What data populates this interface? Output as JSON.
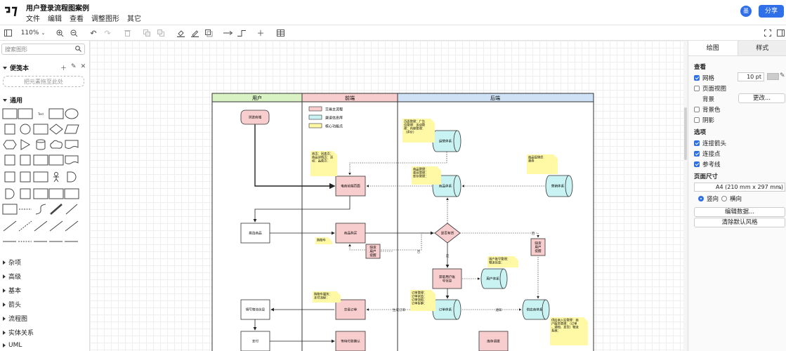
{
  "app": {
    "title": "用户登录流程图案例",
    "avatar_letter": "墨",
    "share_label": "分享"
  },
  "menu": [
    "文件",
    "编辑",
    "查看",
    "调整图形",
    "其它"
  ],
  "toolbar": {
    "zoom": "110%"
  },
  "sidebar": {
    "search_placeholder": "搜索图形",
    "favorites_label": "便笺本",
    "drop_hint": "把元素拖至此处",
    "general_label": "通用",
    "libraries": [
      "杂项",
      "高级",
      "基本",
      "箭头",
      "流程图",
      "实体关系",
      "UML"
    ]
  },
  "panel": {
    "tabs": [
      "绘图",
      "样式"
    ],
    "view_title": "查看",
    "grid_label": "网格",
    "grid_size": "10 pt",
    "page_view_label": "页面视图",
    "background_label": "背景",
    "change_label": "更改...",
    "bg_color_label": "背景色",
    "shadow_label": "阴影",
    "options_title": "选项",
    "connection_arrows_label": "连接箭头",
    "connection_points_label": "连接点",
    "guides_label": "参考线",
    "page_size_title": "页面尺寸",
    "page_size_value": "A4 (210 mm x 297 mm)",
    "portrait_label": "竖向",
    "landscape_label": "横向",
    "edit_data_label": "编辑数据...",
    "clear_style_label": "清除默认风格"
  },
  "diagram": {
    "lanes": [
      "用户",
      "前端",
      "后端"
    ],
    "legend": [
      "交易主流程",
      "渠道信息库",
      "核心功能点"
    ],
    "nodes": {
      "browse": "浏览商城",
      "home": "电商前端页面",
      "select": "挑选商品",
      "buy": "商品购买",
      "fill": "填写物流信息",
      "order": "交易订单",
      "pay": "支付",
      "wait": "等待付款确认",
      "ops": "运营体系",
      "goods": "商品体系",
      "market": "营销体系",
      "exist": "是否有货",
      "getuser": "获取用户账号信息",
      "user": "用户体系",
      "ordersys": "订单体系",
      "supply": "供应商体系",
      "stock": "库存调拨",
      "lack": "缺货用户提醒",
      "lack2": "缺货用户提醒"
    },
    "notes": {
      "frontnote": "首页：列表页：商品详情页：活动：品类页：",
      "opsnote": "页面管理：广告位管理：活动管理：内容管理：（评价）",
      "goodsnote": "商品管理：类目管理：库存管理：",
      "marketnote": "商品促销优惠券",
      "cartnote": "购物车",
      "usernote": "用户账号管理：物流信息：",
      "cartpay": "购物车服务：支付流程：",
      "ordernote": "订单管理：订单状态：订单快照：订单拆解：",
      "supplynote": "供应商入驻管理：商户服务管理：（订单、通知、发货）物流系统："
    },
    "labels": {
      "no": "否",
      "no2": "否",
      "yes": "是",
      "gen": "生成订单",
      "notify": "通知"
    }
  }
}
